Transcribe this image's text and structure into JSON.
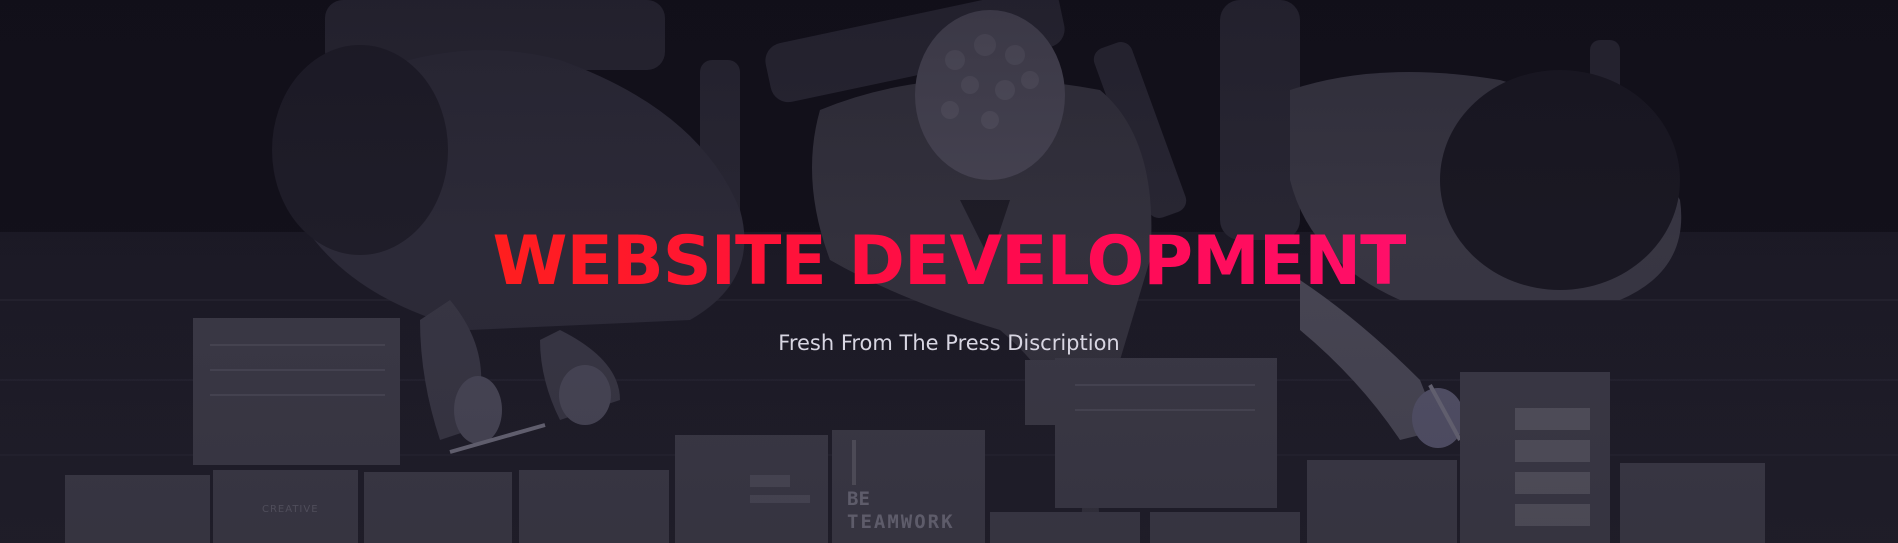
{
  "hero": {
    "title": "WEBSITE DEVELOPMENT",
    "subtitle": "Fresh From The Press Discription",
    "background_image": "team-meeting-desk-photo",
    "poster_text_line1": "BE",
    "poster_text_line2": "TEAMWORK",
    "paper_text": "CREATIVE"
  },
  "colors": {
    "title_gradient_start": "#ff1e1e",
    "title_gradient_end": "#ff0f6a",
    "subtitle": "#d8d6e2",
    "background": "#15131f"
  }
}
